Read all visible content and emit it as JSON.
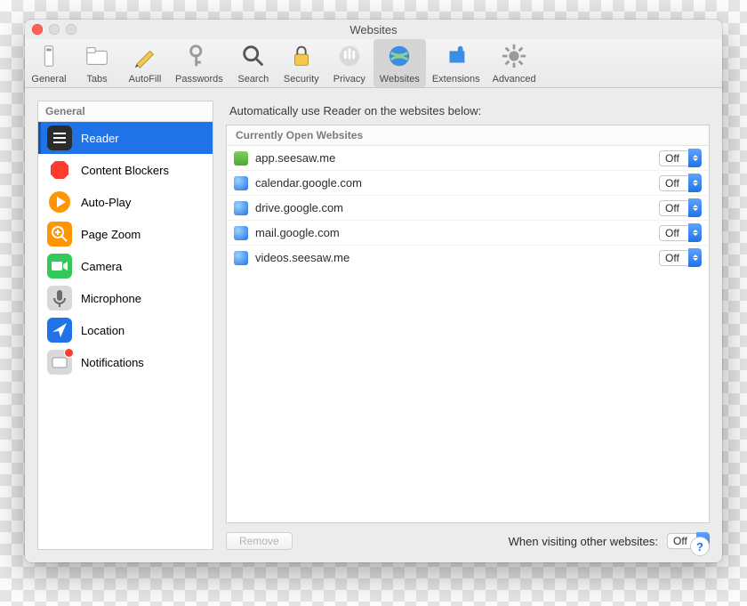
{
  "window": {
    "title": "Websites"
  },
  "toolbar": [
    {
      "id": "general",
      "label": "General"
    },
    {
      "id": "tabs",
      "label": "Tabs"
    },
    {
      "id": "autofill",
      "label": "AutoFill"
    },
    {
      "id": "passwords",
      "label": "Passwords"
    },
    {
      "id": "search",
      "label": "Search"
    },
    {
      "id": "security",
      "label": "Security"
    },
    {
      "id": "privacy",
      "label": "Privacy"
    },
    {
      "id": "websites",
      "label": "Websites",
      "active": true
    },
    {
      "id": "extensions",
      "label": "Extensions"
    },
    {
      "id": "advanced",
      "label": "Advanced"
    }
  ],
  "sidebar": {
    "header": "General",
    "items": [
      {
        "id": "reader",
        "label": "Reader",
        "selected": true
      },
      {
        "id": "contentblockers",
        "label": "Content Blockers"
      },
      {
        "id": "autoplay",
        "label": "Auto-Play"
      },
      {
        "id": "pagezoom",
        "label": "Page Zoom"
      },
      {
        "id": "camera",
        "label": "Camera"
      },
      {
        "id": "microphone",
        "label": "Microphone"
      },
      {
        "id": "location",
        "label": "Location"
      },
      {
        "id": "notifications",
        "label": "Notifications",
        "badge": true
      }
    ]
  },
  "pane": {
    "heading": "Automatically use Reader on the websites below:",
    "table_header": "Currently Open Websites",
    "rows": [
      {
        "fav": "green",
        "label": "app.seesaw.me",
        "value": "Off"
      },
      {
        "fav": "globe",
        "label": "calendar.google.com",
        "value": "Off"
      },
      {
        "fav": "globe",
        "label": "drive.google.com",
        "value": "Off"
      },
      {
        "fav": "globe",
        "label": "mail.google.com",
        "value": "Off"
      },
      {
        "fav": "globe",
        "label": "videos.seesaw.me",
        "value": "Off"
      }
    ],
    "remove_label": "Remove",
    "other_label": "When visiting other websites:",
    "other_value": "Off"
  },
  "icons": {
    "general": "switch",
    "tabs": "tabs",
    "autofill": "pencil",
    "passwords": "key",
    "search": "magnifier",
    "security": "lock",
    "privacy": "hand",
    "websites": "globe",
    "extensions": "puzzle",
    "advanced": "gear"
  }
}
